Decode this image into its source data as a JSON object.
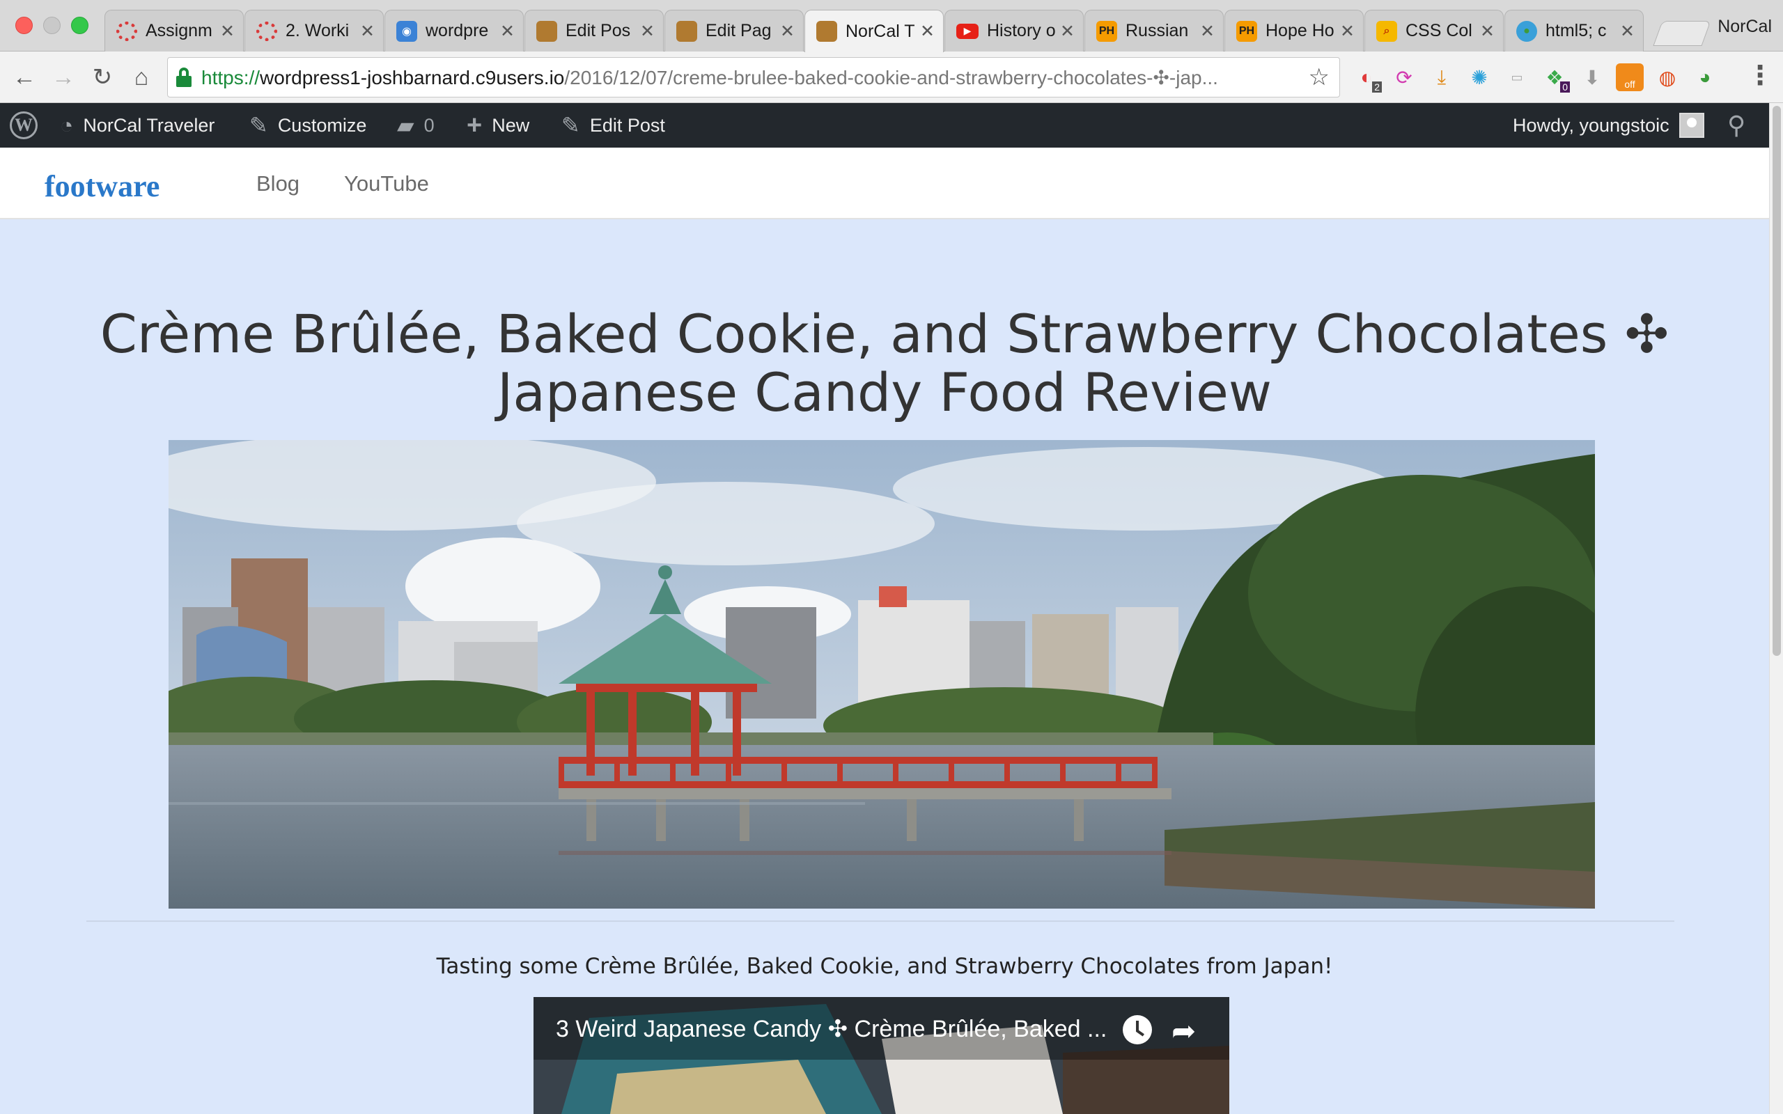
{
  "browser": {
    "tabs": [
      {
        "title": "Assignm",
        "icon_color": "#d93a3a",
        "icon": "gear-icon"
      },
      {
        "title": "2. Worki",
        "icon_color": "#d93a3a",
        "icon": "gear-icon"
      },
      {
        "title": "wordpre",
        "icon_color": "#3b82d6",
        "icon": "eye-icon"
      },
      {
        "title": "Edit Pos",
        "icon_color": "#b07a30",
        "icon": "suitcase-icon"
      },
      {
        "title": "Edit Pag",
        "icon_color": "#b07a30",
        "icon": "suitcase-icon"
      },
      {
        "title": "NorCal T",
        "icon_color": "#b07a30",
        "icon": "suitcase-icon",
        "active": true
      },
      {
        "title": "History o",
        "icon_color": "#e62117",
        "icon": "youtube-icon"
      },
      {
        "title": "Russian",
        "icon_color": "#f59b00",
        "icon": "ph-icon",
        "icon_text": "PH"
      },
      {
        "title": "Hope Ho",
        "icon_color": "#f59b00",
        "icon": "ph-icon",
        "icon_text": "PH"
      },
      {
        "title": "CSS Col",
        "icon_color": "#f5b800",
        "icon": "search-icon"
      },
      {
        "title": "html5; c",
        "icon_color": "#3aa0d9",
        "icon": "globe-icon"
      }
    ],
    "profile_label": "NorCal",
    "url": {
      "scheme": "https://",
      "host": "wordpress1-joshbarnard.c9users.io",
      "path": "/2016/12/07/creme-brulee-baked-cookie-and-strawberry-chocolates-✣-jap..."
    },
    "extension_badges": [
      "2",
      "0"
    ],
    "extension_off_label": "off"
  },
  "adminbar": {
    "site_name": "NorCal Traveler",
    "customize": "Customize",
    "comments_count": "0",
    "new": "New",
    "edit_post": "Edit Post",
    "howdy": "Howdy, youngstoic"
  },
  "site": {
    "brand": "footware",
    "nav": [
      "Blog",
      "YouTube"
    ]
  },
  "post": {
    "title": "Crème Brûlée, Baked Cookie, and Strawberry Chocolates ✣ Japanese Candy Food Review",
    "excerpt": "Tasting some Crème Brûlée, Baked Cookie, and Strawberry Chocolates from Japan!",
    "video_title": "3 Weird Japanese Candy ✣ Crème Brûlée, Baked ..."
  },
  "colors": {
    "page_bg": "#dbe7fb",
    "adminbar_bg": "#23282d",
    "brand": "#2a78c9",
    "secure_green": "#1a8a3a"
  }
}
